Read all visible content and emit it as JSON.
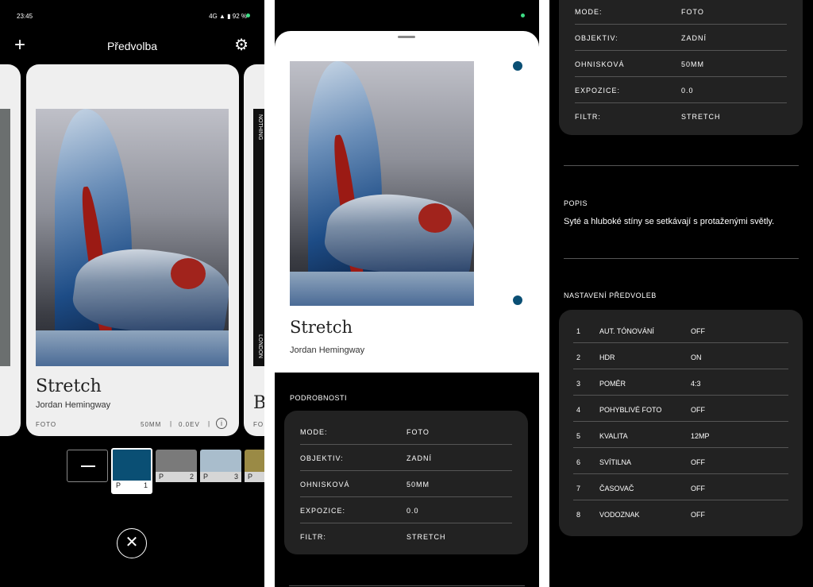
{
  "status": {
    "time": "23:45",
    "network": "4G",
    "battery": "92 %"
  },
  "header": {
    "title": "Předvolba"
  },
  "card": {
    "title": "Stretch",
    "author": "Jordan Hemingway",
    "mode": "FOTO",
    "lens": "50MM",
    "exposure": "0.0EV",
    "side_top": "NOTHING",
    "side_bottom": "LONDON",
    "next_initial": "B",
    "next_mode": "FO"
  },
  "swatches": [
    {
      "label": "",
      "color": "#000000"
    },
    {
      "p": "P",
      "n": "1",
      "color": "#0a4f74"
    },
    {
      "p": "P",
      "n": "2",
      "color": "#7a7a7a"
    },
    {
      "p": "P",
      "n": "3",
      "color": "#a9bdcc"
    },
    {
      "p": "P",
      "n": "",
      "color": "#9a8a45"
    }
  ],
  "details": {
    "heading": "PODROBNOSTI",
    "rows": [
      {
        "k": "MODE:",
        "v": "FOTO"
      },
      {
        "k": "OBJEKTIV:",
        "v": "ZADNÍ"
      },
      {
        "k": "OHNISKOVÁ",
        "v": "50MM"
      },
      {
        "k": "EXPOZICE:",
        "v": "0.0"
      },
      {
        "k": "FILTR:",
        "v": "STRETCH"
      }
    ]
  },
  "description": {
    "heading": "POPIS",
    "text": "Syté a hluboké stíny se setkávají s protaženými světly."
  },
  "settings": {
    "heading": "NASTAVENÍ PŘEDVOLEB",
    "rows": [
      {
        "i": "1",
        "k": "AUT. TÓNOVÁNÍ",
        "v": "OFF"
      },
      {
        "i": "2",
        "k": "HDR",
        "v": "ON"
      },
      {
        "i": "3",
        "k": "POMĚR",
        "v": "4:3"
      },
      {
        "i": "4",
        "k": "POHYBLIVÉ FOTO",
        "v": "OFF"
      },
      {
        "i": "5",
        "k": "KVALITA",
        "v": "12MP"
      },
      {
        "i": "6",
        "k": "SVÍTILNA",
        "v": "OFF"
      },
      {
        "i": "7",
        "k": "ČASOVAČ",
        "v": "OFF"
      },
      {
        "i": "8",
        "k": "VODOZNAK",
        "v": "OFF"
      }
    ]
  }
}
